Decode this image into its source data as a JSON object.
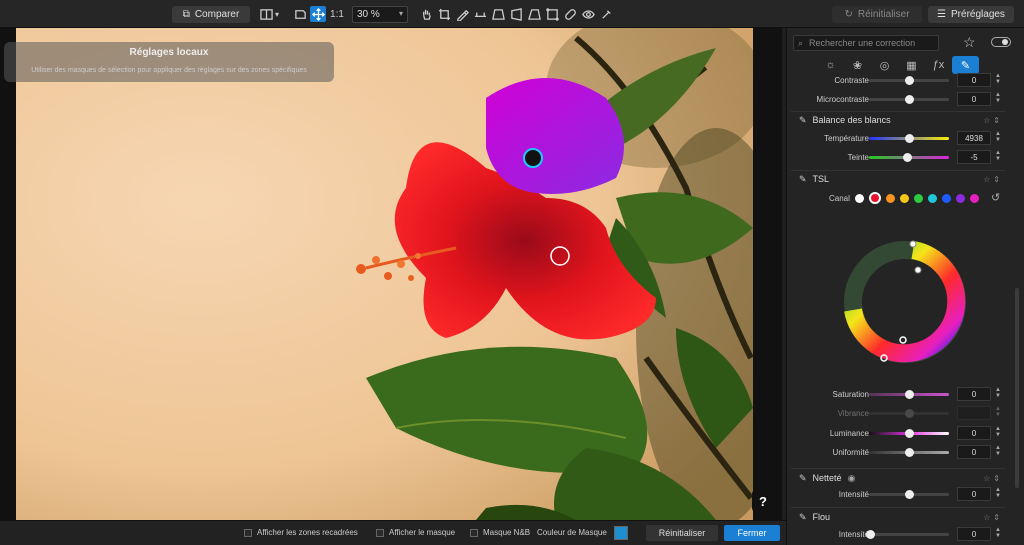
{
  "toolbar": {
    "compare_label": "Comparer",
    "one_to_one": "1:1",
    "zoom_value": "30 %",
    "reset_label": "Réinitialiser",
    "presets_label": "Préréglages"
  },
  "local_panel": {
    "title": "Réglages locaux",
    "subtitle": "Utiliser des masques de sélection pour appliquer des réglages sur des zones spécifiques"
  },
  "help_label": "?",
  "bottom_bar": {
    "show_cropped": "Afficher les zones recadrées",
    "show_mask": "Afficher le masque",
    "mask_bw": "Masque N&B",
    "mask_color": "Couleur de Masque",
    "mask_color_hex": "#1b8fd0",
    "reset": "Réinitialiser",
    "close": "Fermer"
  },
  "sidebar": {
    "search_placeholder": "Rechercher une correction",
    "rows": {
      "contraste": {
        "label": "Contraste",
        "value": "0",
        "pos": 0.5
      },
      "microcontraste": {
        "label": "Microcontraste",
        "value": "0",
        "pos": 0.5
      },
      "temperature": {
        "label": "Température",
        "value": "4938",
        "pos": 0.5
      },
      "teinte": {
        "label": "Teinte",
        "value": "-5",
        "pos": 0.48
      },
      "saturation": {
        "label": "Saturation",
        "value": "0",
        "pos": 0.5
      },
      "vibrance": {
        "label": "Vibrance",
        "value": "",
        "pos": 0.5
      },
      "luminance": {
        "label": "Luminance",
        "value": "0",
        "pos": 0.5
      },
      "uniformite": {
        "label": "Uniformité",
        "value": "0",
        "pos": 0.5
      },
      "nettete_intensite": {
        "label": "Intensité",
        "value": "0",
        "pos": 0.5
      },
      "flou_intensite": {
        "label": "Intensité",
        "value": "0",
        "pos": 0.02
      }
    },
    "sections": {
      "white_balance": "Balance des blancs",
      "tsl": "TSL",
      "canal": "Canal",
      "nettete": "Netteté",
      "flou": "Flou"
    },
    "channel_colors": [
      "#ffffff",
      "#e8102a",
      "#f7931e",
      "#f5c518",
      "#2ecc40",
      "#1ec8d8",
      "#1f5cff",
      "#8b2be2",
      "#e81fbf"
    ]
  }
}
